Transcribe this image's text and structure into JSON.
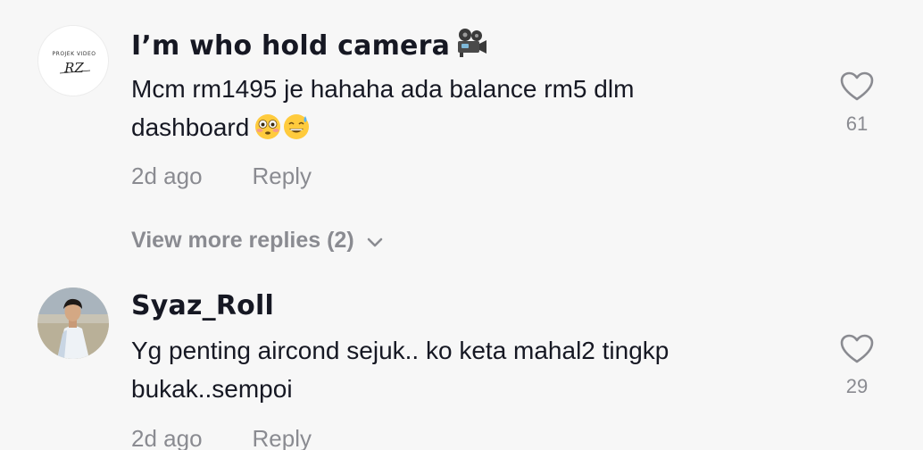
{
  "comments": [
    {
      "username": "I’m who hold camera",
      "name_emoji": "movie-camera-icon",
      "avatar_text_top": "PROJEK VIDEO",
      "avatar_text_logo": "RZ",
      "text_line1": "Mcm rm1495 je hahaha ada balance rm5 dlm",
      "text_line2": "dashboard",
      "text_emojis": [
        "flushed-face-emoji",
        "grinning-sweat-emoji"
      ],
      "time": "2d ago",
      "reply_label": "Reply",
      "like_count": "61",
      "view_more_label": "View more replies (2)"
    },
    {
      "username": "Syaz_Roll",
      "text_line1": "Yg penting aircond sejuk.. ko keta mahal2 tingkp",
      "text_line2": "bukak..sempoi",
      "time": "2d ago",
      "reply_label": "Reply",
      "like_count": "29"
    }
  ],
  "colors": {
    "background": "#f7f7f7",
    "primary_text": "#161823",
    "secondary_text": "#8a8b91"
  }
}
